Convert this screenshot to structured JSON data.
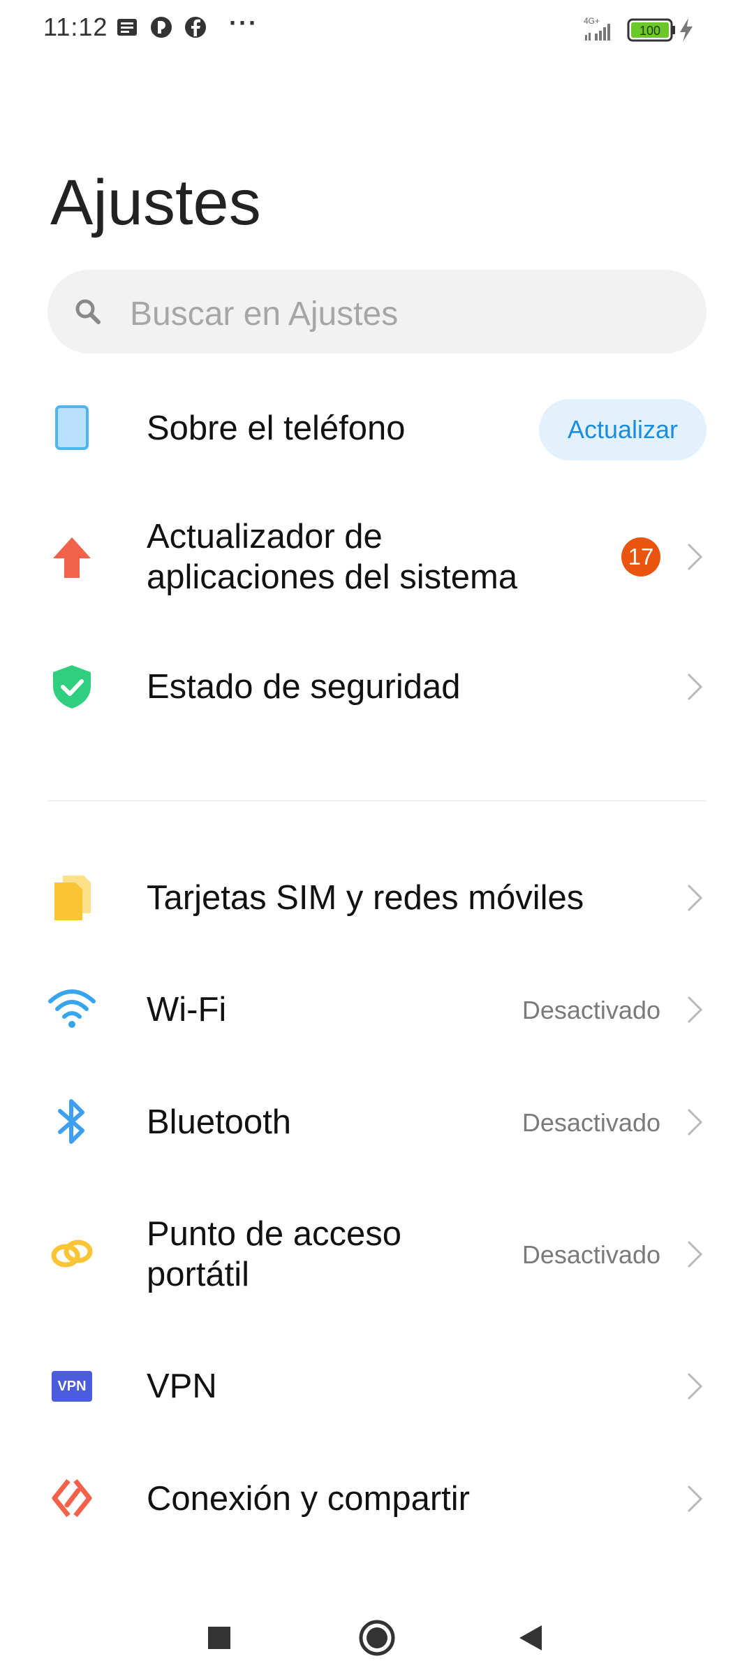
{
  "status_bar": {
    "time": "11:12",
    "network": "4G+",
    "battery": "100",
    "more": "···"
  },
  "page": {
    "title": "Ajustes"
  },
  "search": {
    "placeholder": "Buscar en Ajustes"
  },
  "top_items": [
    {
      "label": "Sobre el teléfono",
      "button": "Actualizar",
      "icon": "phone-icon",
      "color": "#4fb3ef"
    },
    {
      "label_line1": "Actualizador de",
      "label_line2": "aplicaciones del sistema",
      "badge": "17",
      "icon": "arrow-up-icon",
      "color": "#f2614a"
    },
    {
      "label": "Estado de seguridad",
      "icon": "shield-check-icon",
      "color": "#2fcf7d"
    }
  ],
  "network_items": [
    {
      "label": "Tarjetas SIM y redes móviles",
      "icon": "sim-card-icon",
      "color": "#fbc434"
    },
    {
      "label": "Wi-Fi",
      "value": "Desactivado",
      "icon": "wifi-icon",
      "color": "#38a4ee"
    },
    {
      "label": "Bluetooth",
      "value": "Desactivado",
      "icon": "bluetooth-icon",
      "color": "#3e9ff0"
    },
    {
      "label_line1": "Punto de acceso",
      "label_line2": "portátil",
      "value": "Desactivado",
      "icon": "hotspot-icon",
      "color": "#fbc434"
    },
    {
      "label": "VPN",
      "icon_text": "VPN",
      "icon": "vpn-icon",
      "color": "#4a5bdc"
    },
    {
      "label": "Conexión y compartir",
      "icon": "share-connection-icon",
      "color": "#f2614a"
    }
  ],
  "accent_color": "#1a8de0"
}
